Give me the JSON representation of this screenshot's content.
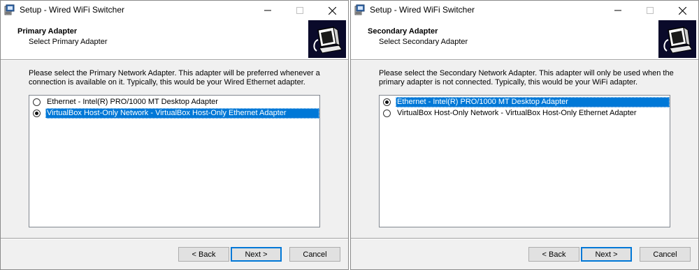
{
  "windows": [
    {
      "title": "Setup - Wired WiFi Switcher",
      "header_title": "Primary Adapter",
      "header_subtitle": "Select Primary Adapter",
      "description": "Please select the Primary Network Adapter. This adapter will be preferred whenever a connection is available on it. Typically, this would be your Wired Ethernet adapter.",
      "options": [
        {
          "label": "Ethernet - Intel(R) PRO/1000 MT Desktop Adapter",
          "selected": false
        },
        {
          "label": "VirtualBox Host-Only Network - VirtualBox Host-Only Ethernet Adapter",
          "selected": true
        }
      ],
      "buttons": {
        "back": "< Back",
        "next": "Next >",
        "cancel": "Cancel"
      }
    },
    {
      "title": "Setup - Wired WiFi Switcher",
      "header_title": "Secondary Adapter",
      "header_subtitle": "Select Secondary Adapter",
      "description": "Please select the Secondary Network Adapter. This adapter will only be used when the primary adapter is not connected. Typically, this would be your WiFi adapter.",
      "options": [
        {
          "label": "Ethernet - Intel(R) PRO/1000 MT Desktop Adapter",
          "selected": true
        },
        {
          "label": "VirtualBox Host-Only Network - VirtualBox Host-Only Ethernet Adapter",
          "selected": false
        }
      ],
      "buttons": {
        "back": "< Back",
        "next": "Next >",
        "cancel": "Cancel"
      }
    }
  ],
  "colors": {
    "selection": "#0078d7",
    "logo_bg": "#0a0a2a",
    "dialog_bg": "#f0f0f0"
  },
  "icons": {
    "app": "setup-installer-icon",
    "logo": "computer-network-icon"
  }
}
